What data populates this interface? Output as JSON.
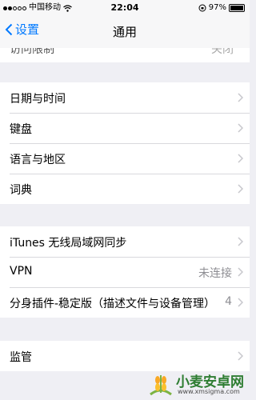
{
  "status_bar": {
    "carrier": "中国移动",
    "time": "22:04",
    "battery": "97%",
    "battery_level": 0.97
  },
  "nav": {
    "back_label": "设置",
    "title": "通用"
  },
  "clipped_row": {
    "label": "访问限制",
    "value": "关闭"
  },
  "group1": [
    {
      "label": "日期与时间"
    },
    {
      "label": "键盘"
    },
    {
      "label": "语言与地区"
    },
    {
      "label": "词典"
    }
  ],
  "group2": [
    {
      "label": "iTunes 无线局域网同步",
      "value": ""
    },
    {
      "label": "VPN",
      "value": "未连接"
    },
    {
      "label": "分身插件-稳定版（描述文件与设备管理）",
      "value": "4"
    }
  ],
  "group3": [
    {
      "label": "监管"
    }
  ],
  "watermark": {
    "name": "小麦安卓网",
    "url": "www.xmsigma.com"
  },
  "colors": {
    "accent": "#0079ff",
    "background": "#efeff4",
    "logo_green": "#2e7d32"
  }
}
